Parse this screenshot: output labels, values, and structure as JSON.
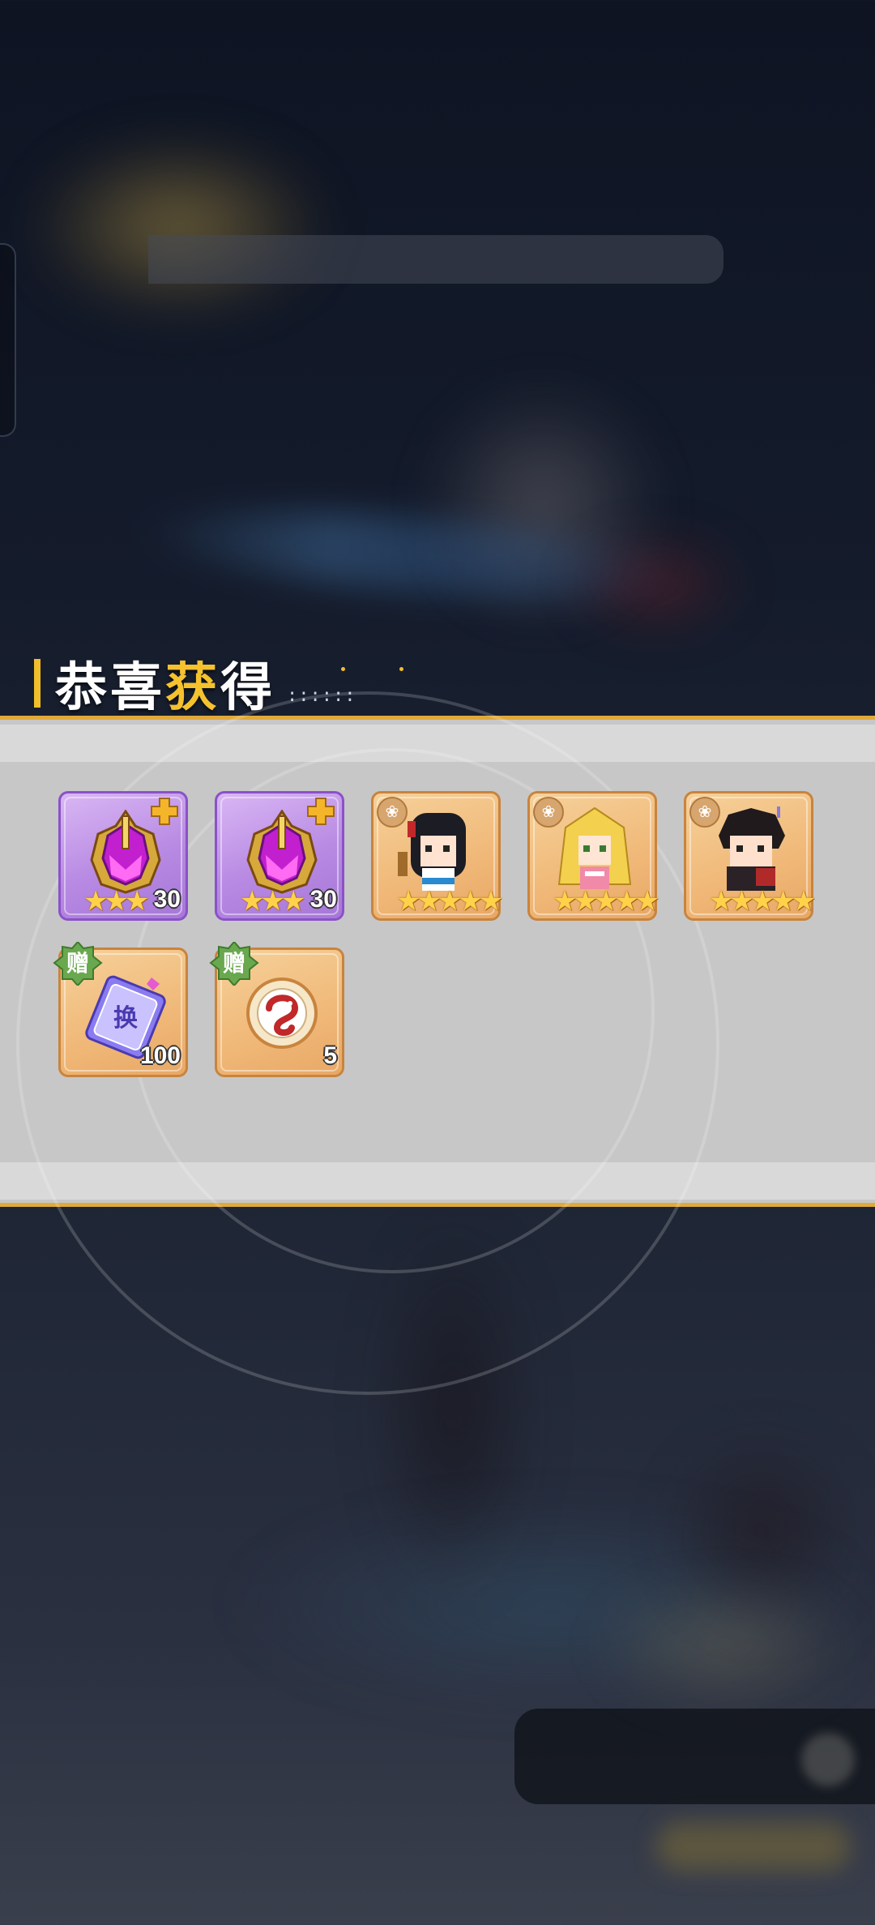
{
  "header": {
    "title_part1": "恭喜",
    "title_highlight": "获",
    "title_part2": "得",
    "dots": "::::::"
  },
  "rewards": [
    {
      "name": "purple-helmet",
      "frame": "purple",
      "stars": "★★★",
      "qty": "30",
      "badge": "gold-cross"
    },
    {
      "name": "purple-helmet",
      "frame": "purple",
      "stars": "★★★",
      "qty": "30",
      "badge": "gold-cross"
    },
    {
      "name": "hero-black-hair-girl",
      "frame": "orange",
      "stars": "★★★★★",
      "qty": "",
      "badge": "lotus"
    },
    {
      "name": "hero-blonde-girl",
      "frame": "orange",
      "stars": "★★★★★",
      "qty": "",
      "badge": "lotus"
    },
    {
      "name": "hero-dark-hair-boy",
      "frame": "orange",
      "stars": "★★★★★",
      "qty": "",
      "badge": "lotus"
    },
    {
      "name": "exchange-ticket",
      "frame": "orange",
      "stars": "",
      "qty": "100",
      "badge": "gift",
      "badge_label": "赠",
      "ticket_label": "换"
    },
    {
      "name": "dragon-token",
      "frame": "orange",
      "stars": "",
      "qty": "5",
      "badge": "gift",
      "badge_label": "赠"
    }
  ],
  "colors": {
    "accent_gold": "#f1be2c",
    "panel_gray": "#c7c7c7",
    "gift_green": "#6aa84f"
  }
}
